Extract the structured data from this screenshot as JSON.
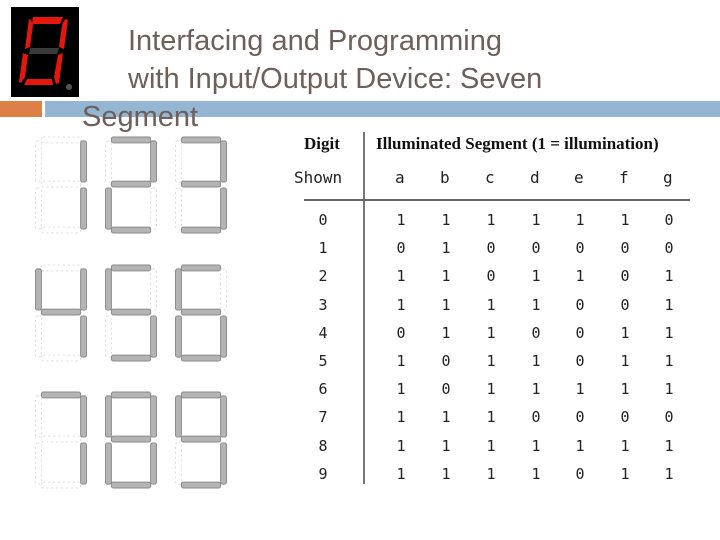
{
  "slide": {
    "title_lines": [
      "Interfacing and Programming",
      "with Input/Output Device: Seven",
      "Segment"
    ],
    "accent_colors": {
      "orange": "#dd8047",
      "blue": "#94b6d2",
      "title_text": "#6e5f5a",
      "logo_segment_on": "#e3170d",
      "logo_segment_off": "#3a3a3a"
    }
  },
  "logo": {
    "icon": "seven-segment-display-icon",
    "digit_shown": "0"
  },
  "digit_images": [
    {
      "digit": "1",
      "segments": [
        0,
        1,
        1,
        0,
        0,
        0,
        0
      ]
    },
    {
      "digit": "2",
      "segments": [
        1,
        1,
        0,
        1,
        1,
        0,
        1
      ]
    },
    {
      "digit": "3",
      "segments": [
        1,
        1,
        1,
        1,
        0,
        0,
        1
      ]
    },
    {
      "digit": "4",
      "segments": [
        0,
        1,
        1,
        0,
        0,
        1,
        1
      ]
    },
    {
      "digit": "5",
      "segments": [
        1,
        0,
        1,
        1,
        0,
        1,
        1
      ]
    },
    {
      "digit": "6",
      "segments": [
        1,
        0,
        1,
        1,
        1,
        1,
        1
      ]
    },
    {
      "digit": "7",
      "segments": [
        1,
        1,
        1,
        0,
        0,
        0,
        0
      ]
    },
    {
      "digit": "8",
      "segments": [
        1,
        1,
        1,
        1,
        1,
        1,
        1
      ]
    },
    {
      "digit": "9",
      "segments": [
        1,
        1,
        1,
        1,
        0,
        1,
        1
      ]
    }
  ],
  "table": {
    "header_left_line1": "Digit",
    "header_left_line2": "Shown",
    "header_right": "Illuminated Segment (1 = illumination)",
    "columns": [
      "a",
      "b",
      "c",
      "d",
      "e",
      "f",
      "g"
    ],
    "rows": [
      {
        "digit": "0",
        "values": [
          "1",
          "1",
          "1",
          "1",
          "1",
          "1",
          "0"
        ]
      },
      {
        "digit": "1",
        "values": [
          "0",
          "1",
          "0",
          "0",
          "0",
          "0",
          "0"
        ]
      },
      {
        "digit": "2",
        "values": [
          "1",
          "1",
          "0",
          "1",
          "1",
          "0",
          "1"
        ]
      },
      {
        "digit": "3",
        "values": [
          "1",
          "1",
          "1",
          "1",
          "0",
          "0",
          "1"
        ]
      },
      {
        "digit": "4",
        "values": [
          "0",
          "1",
          "1",
          "0",
          "0",
          "1",
          "1"
        ]
      },
      {
        "digit": "5",
        "values": [
          "1",
          "0",
          "1",
          "1",
          "0",
          "1",
          "1"
        ]
      },
      {
        "digit": "6",
        "values": [
          "1",
          "0",
          "1",
          "1",
          "1",
          "1",
          "1"
        ]
      },
      {
        "digit": "7",
        "values": [
          "1",
          "1",
          "1",
          "0",
          "0",
          "0",
          "0"
        ]
      },
      {
        "digit": "8",
        "values": [
          "1",
          "1",
          "1",
          "1",
          "1",
          "1",
          "1"
        ]
      },
      {
        "digit": "9",
        "values": [
          "1",
          "1",
          "1",
          "1",
          "0",
          "1",
          "1"
        ]
      }
    ]
  }
}
